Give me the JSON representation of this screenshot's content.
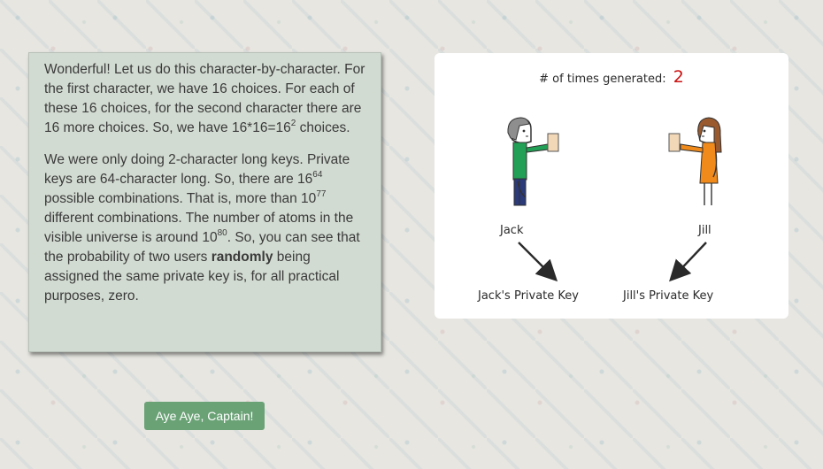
{
  "card": {
    "p1": {
      "t1": "Wonderful! Let us do this character-by-character. For the first character, we have 16 choices. For each of these 16 choices, for the second character there are 16 more choices. So, we have 16*16=16",
      "s1": "2",
      "t2": " choices."
    },
    "p2": {
      "t1": "We were only doing 2-character long keys. Private keys are 64-character long. So, there are 16",
      "s1": "64",
      "t2": " possible combinations. That is, more than 10",
      "s2": "77",
      "t3": " different combinations. The number of atoms in the visible universe is around 10",
      "s3": "80",
      "t4": ". So, you can see that the probability of two users ",
      "bold": "randomly",
      "t5": " being assigned the same private key is, for all practical purposes, zero."
    }
  },
  "button": {
    "label": "Aye Aye, Captain!"
  },
  "diagram": {
    "counter_label": "# of times generated:",
    "counter_value": "2",
    "left_person": "Jack",
    "right_person": "Jill",
    "left_key": "Jack's Private Key",
    "right_key": "Jill's Private Key"
  },
  "colors": {
    "card_bg": "#d2dbd2",
    "button_bg": "#6aa276",
    "counter_value": "#cc1111",
    "jack_shirt": "#22a055",
    "jack_pants": "#2a3a7a",
    "jill_dress": "#f08a1a"
  }
}
